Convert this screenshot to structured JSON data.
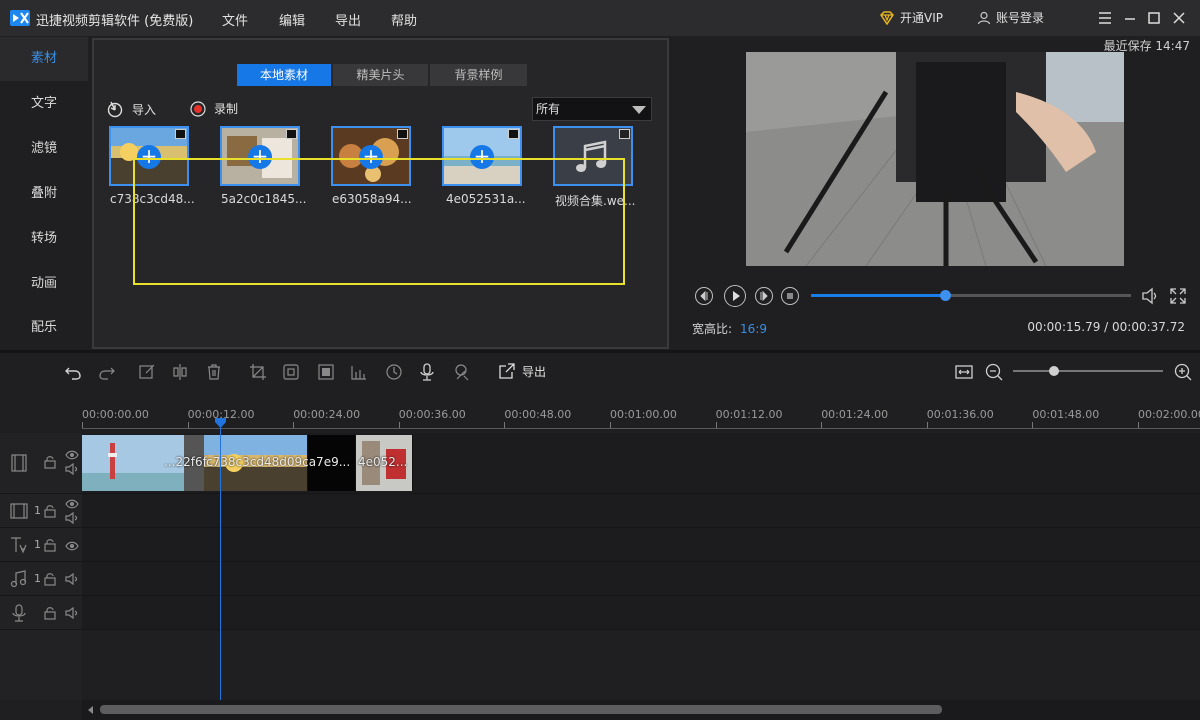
{
  "app": {
    "title": "迅捷视频剪辑软件 (免费版)",
    "menu": [
      "文件",
      "编辑",
      "导出",
      "帮助"
    ],
    "vip_label": "开通VIP",
    "login_label": "账号登录"
  },
  "sidebar": {
    "items": [
      {
        "label": "素材",
        "active": true
      },
      {
        "label": "文字"
      },
      {
        "label": "滤镜"
      },
      {
        "label": "叠附"
      },
      {
        "label": "转场"
      },
      {
        "label": "动画"
      },
      {
        "label": "配乐"
      }
    ]
  },
  "media": {
    "tabs": [
      {
        "label": "本地素材",
        "active": true
      },
      {
        "label": "精美片头"
      },
      {
        "label": "背景样例"
      }
    ],
    "import_label": "导入",
    "record_label": "录制",
    "filter_value": "所有",
    "items": [
      {
        "name": "c738c3cd48...",
        "kind": "video"
      },
      {
        "name": "5a2c0c1845...",
        "kind": "video"
      },
      {
        "name": "e63058a94...",
        "kind": "video"
      },
      {
        "name": "4e052531a...",
        "kind": "video"
      },
      {
        "name": "视频合集.we...",
        "kind": "audio"
      }
    ]
  },
  "preview": {
    "last_save": "最近保存 14:47",
    "aspect_label": "宽高比:",
    "aspect_value": "16:9",
    "timecode": "00:00:15.79 / 00:00:37.72",
    "progress": 0.4186
  },
  "timeline": {
    "export_label": "导出",
    "zoom_level": 0.27,
    "ruler": [
      "00:00:00.00",
      "00:00:12.00",
      "00:00:24.00",
      "00:00:36.00",
      "00:00:48.00",
      "00:01:00.00",
      "00:01:12.00",
      "00:01:24.00",
      "00:01:36.00",
      "00:01:48.00",
      "00:02:00.00"
    ],
    "clips": [
      {
        "label": "...22f6f..."
      },
      {
        "label": "c738c3cd48d09ca7e9..."
      },
      {
        "label": "4e052..."
      }
    ],
    "track_numbers": [
      "1",
      "1",
      "1"
    ]
  },
  "colors": {
    "accent": "#1677e6",
    "selection": "#e8e02a",
    "background": "#1f1f21"
  }
}
